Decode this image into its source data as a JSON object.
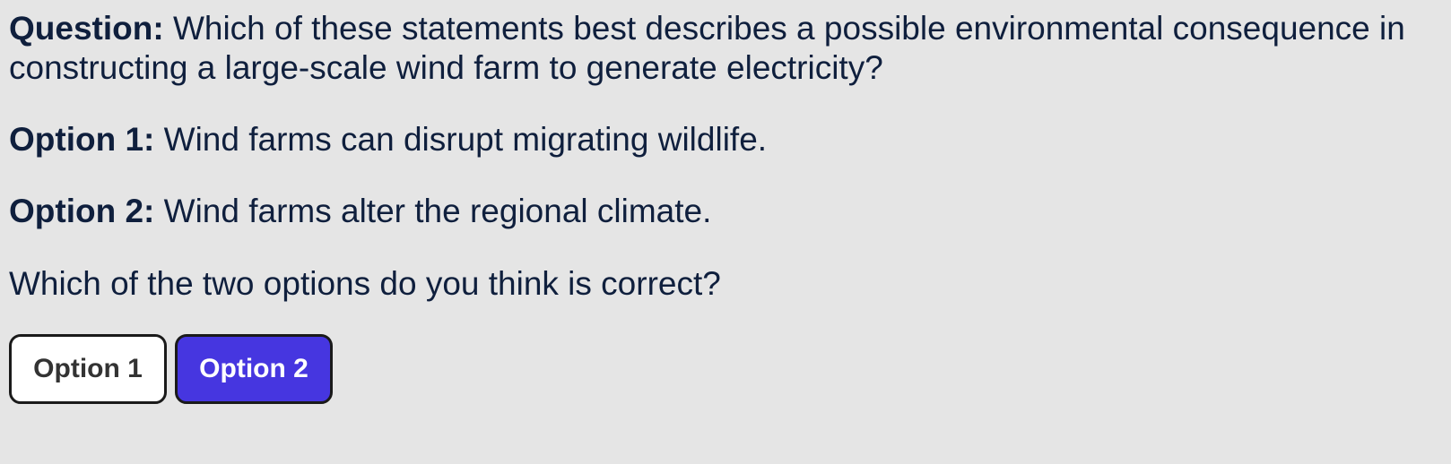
{
  "question": {
    "label": "Question:",
    "text": " Which of these statements best describes a possible environmental consequence in constructing a large-scale wind farm to generate electricity?"
  },
  "options": [
    {
      "label": "Option 1:",
      "text": " Wind farms can disrupt migrating wildlife."
    },
    {
      "label": "Option 2:",
      "text": " Wind farms alter the regional climate."
    }
  ],
  "prompt": "Which of the two options do you think is correct?",
  "buttons": {
    "option1_label": "Option 1",
    "option2_label": "Option 2"
  },
  "colors": {
    "background": "#e5e5e5",
    "text": "#0f1f3d",
    "selected_button": "#4636e0",
    "unselected_button": "#ffffff"
  }
}
